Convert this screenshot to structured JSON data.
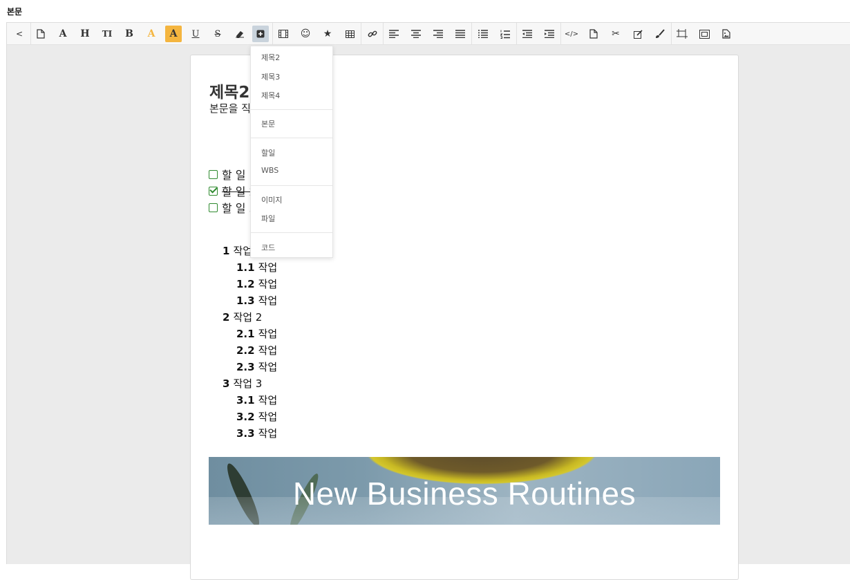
{
  "page": {
    "label": "본문"
  },
  "toolbar": {
    "items": [
      {
        "name": "collapse",
        "text": "<"
      },
      {
        "name": "new-document",
        "icon": "file-icon"
      },
      {
        "name": "font",
        "text": "A"
      },
      {
        "name": "heading",
        "text": "H"
      },
      {
        "name": "text-size",
        "text": "TI"
      },
      {
        "name": "bold",
        "text": "B"
      },
      {
        "name": "font-color",
        "text": "A"
      },
      {
        "name": "highlight",
        "text": "A"
      },
      {
        "name": "underline",
        "text": "U"
      },
      {
        "name": "strikethrough",
        "text": "S"
      },
      {
        "name": "eraser",
        "icon": "eraser-icon"
      },
      {
        "name": "insert",
        "icon": "plus-square-icon"
      },
      {
        "name": "video",
        "icon": "film-icon"
      },
      {
        "name": "emoji",
        "text": "☺"
      },
      {
        "name": "star",
        "text": "★"
      },
      {
        "name": "table",
        "icon": "table-icon"
      },
      {
        "name": "link",
        "icon": "link-icon"
      },
      {
        "name": "align-left",
        "icon": "align-left-icon"
      },
      {
        "name": "align-center",
        "icon": "align-center-icon"
      },
      {
        "name": "align-right",
        "icon": "align-right-icon"
      },
      {
        "name": "justify",
        "icon": "justify-icon"
      },
      {
        "name": "bullet-list",
        "icon": "bullet-list-icon"
      },
      {
        "name": "numbered-list",
        "icon": "numbered-list-icon"
      },
      {
        "name": "outdent",
        "icon": "outdent-icon"
      },
      {
        "name": "indent",
        "icon": "indent-icon"
      },
      {
        "name": "code",
        "text": "</>"
      },
      {
        "name": "file",
        "icon": "file-icon"
      },
      {
        "name": "cut",
        "text": "✂"
      },
      {
        "name": "edit",
        "icon": "edit-icon"
      },
      {
        "name": "brush",
        "icon": "brush-icon"
      },
      {
        "name": "resize-1",
        "icon": "resize-icon"
      },
      {
        "name": "resize-2",
        "icon": "frame-icon"
      },
      {
        "name": "image",
        "icon": "image-icon"
      }
    ]
  },
  "dropdown": {
    "groups": [
      [
        "제목2",
        "제목3",
        "제목4"
      ],
      [
        "본문"
      ],
      [
        "할일",
        "WBS"
      ],
      [
        "이미지",
        "파일"
      ],
      [
        "코드"
      ]
    ]
  },
  "document": {
    "heading": "제목2",
    "body": "본문을 직",
    "todos": [
      {
        "text": "할 일 1",
        "checked": false
      },
      {
        "text": "할 일 2",
        "checked": true
      },
      {
        "text": "할 일 3",
        "checked": false
      }
    ],
    "wbs": [
      {
        "num": "1",
        "label": "작업",
        "level": 0
      },
      {
        "num": "1.1",
        "label": "작업",
        "level": 1
      },
      {
        "num": "1.2",
        "label": "작업",
        "level": 1
      },
      {
        "num": "1.3",
        "label": "작업",
        "level": 1
      },
      {
        "num": "2",
        "label": "작업 2",
        "level": 0
      },
      {
        "num": "2.1",
        "label": "작업",
        "level": 1
      },
      {
        "num": "2.2",
        "label": "작업",
        "level": 1
      },
      {
        "num": "2.3",
        "label": "작업",
        "level": 1
      },
      {
        "num": "3",
        "label": "작업 3",
        "level": 0
      },
      {
        "num": "3.1",
        "label": "작업",
        "level": 1
      },
      {
        "num": "3.2",
        "label": "작업",
        "level": 1
      },
      {
        "num": "3.3",
        "label": "작업",
        "level": 1
      }
    ],
    "banner": {
      "title": "New Business Routines"
    }
  },
  "colors": {
    "accent": "#f4b53f",
    "check": "#2f8a2f",
    "active": "#c9d3dc"
  }
}
